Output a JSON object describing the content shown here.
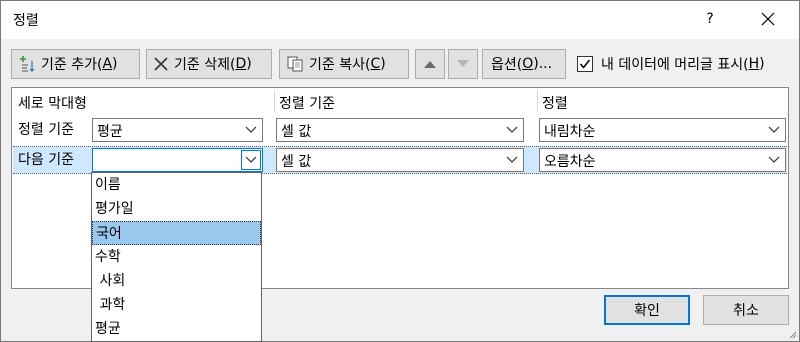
{
  "window": {
    "title": "정렬",
    "help": "?",
    "close": "✕"
  },
  "toolbar": {
    "add_label": "기준 추가(",
    "add_key": "A",
    "delete_label": "기준 삭제(",
    "delete_key": "D",
    "copy_label": "기준 복사(",
    "copy_key": "C",
    "options_label": "옵션(",
    "options_key": "O",
    "options_suffix": ")...",
    "close_paren": ")",
    "header_checkbox_label": "내 데이터에 머리글 표시(",
    "header_checkbox_key": "H",
    "header_checkbox_checked": true
  },
  "grid": {
    "headers": [
      "세로 막대형",
      "정렬 기준",
      "정렬"
    ],
    "rows": [
      {
        "label": "정렬 기준",
        "column": "평균",
        "sort_on": "셀 값",
        "order": "내림차순"
      },
      {
        "label": "다음 기준",
        "column": "",
        "sort_on": "셀 값",
        "order": "오름차순"
      }
    ]
  },
  "dropdown": {
    "options": [
      "이름",
      "평가일",
      "국어",
      "수학",
      " 사회",
      " 과학",
      "평균"
    ],
    "selected_index": 2
  },
  "buttons": {
    "ok": "확인",
    "cancel": "취소"
  },
  "colors": {
    "accent": "#0078d7",
    "selection": "#99c9ef",
    "row_highlight": "#cde8ff"
  }
}
